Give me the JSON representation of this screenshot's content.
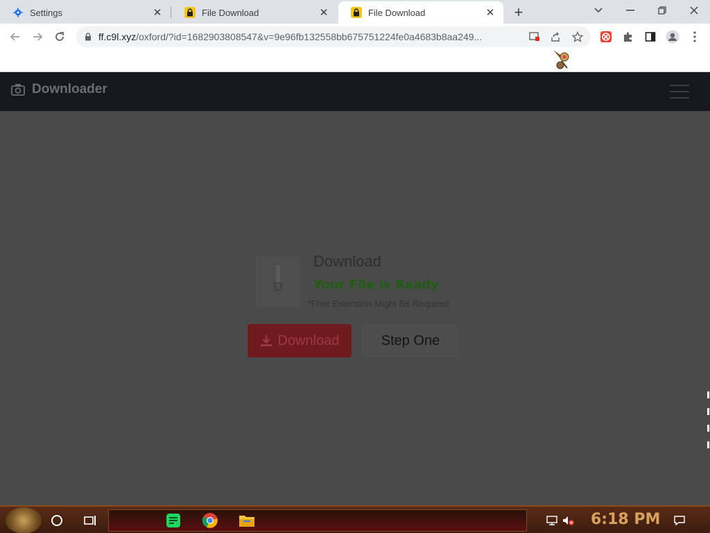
{
  "browser": {
    "tabs": [
      {
        "title": "Settings",
        "icon": "gear-icon",
        "active": false
      },
      {
        "title": "File Download",
        "icon": "lock-icon",
        "active": false
      },
      {
        "title": "File Download",
        "icon": "lock-icon",
        "active": true
      }
    ],
    "url_host": "ff.c9l.xyz",
    "url_path": "/oxford/?id=1682903808547&v=9e96fb132558bb675751224fe0a4683b8aa249..."
  },
  "site": {
    "brand": "Downloader",
    "download_title": "Download",
    "ready_text": "Your File is Ready",
    "note": "*Free Extension Might Be Required",
    "download_button": "Download",
    "step_button": "Step One"
  },
  "taskbar": {
    "clock": "6:18 PM"
  },
  "colors": {
    "accent_red": "#6e1a1e",
    "ready_green": "#1f5e12",
    "overlay": "#4a4a4a"
  }
}
